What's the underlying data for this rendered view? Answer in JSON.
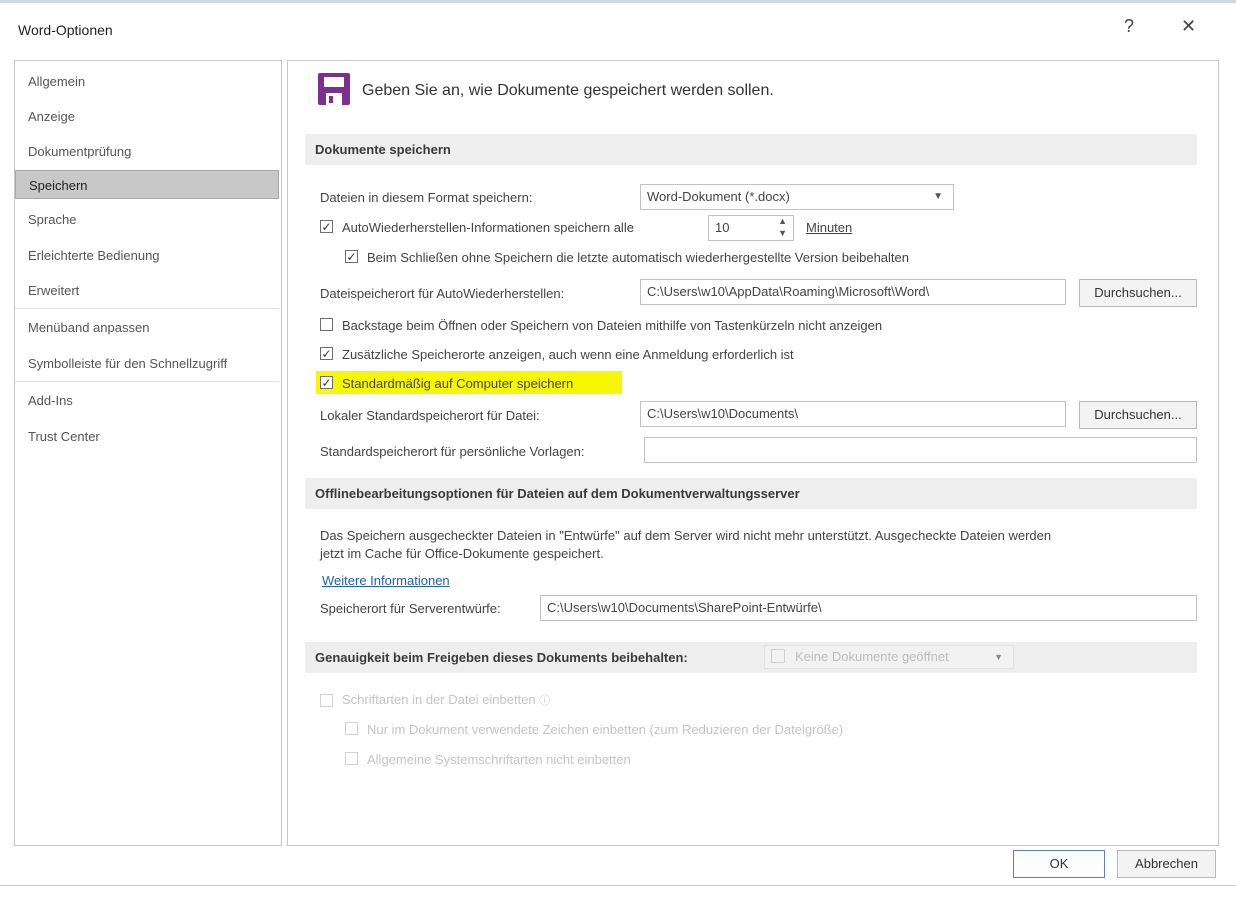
{
  "window": {
    "title": "Word-Optionen",
    "help": "?",
    "close": "✕"
  },
  "sidebar": {
    "items": [
      {
        "label": "Allgemein"
      },
      {
        "label": "Anzeige"
      },
      {
        "label": "Dokumentprüfung"
      },
      {
        "label": "Speichern",
        "selected": true
      },
      {
        "label": "Sprache"
      },
      {
        "label": "Erleichterte Bedienung"
      },
      {
        "label": "Erweitert"
      },
      {
        "label": "Menüband anpassen"
      },
      {
        "label": "Symbolleiste für den Schnellzugriff"
      },
      {
        "label": "Add-Ins"
      },
      {
        "label": "Trust Center"
      }
    ]
  },
  "header": {
    "text": "Geben Sie an, wie Dokumente gespeichert werden sollen.",
    "icon": "save-icon",
    "icon_color": "#7b2f8f"
  },
  "save_docs": {
    "title": "Dokumente speichern",
    "format_label": "Dateien in diesem Format speichern:",
    "format_value": "Word-Dokument (*.docx)",
    "autorecover_label": "AutoWiederherstellen-Informationen speichern alle",
    "autorecover_checked": true,
    "autorecover_minutes": "10",
    "minutes_label": "Minuten",
    "keep_last_label": "Beim Schließen ohne Speichern die letzte automatisch wiederhergestellte Version beibehalten",
    "keep_last_checked": true,
    "autorecover_location_label": "Dateispeicherort für AutoWiederherstellen:",
    "autorecover_location_value": "C:\\Users\\w10\\AppData\\Roaming\\Microsoft\\Word\\",
    "browse_label": "Durchsuchen...",
    "backstage_label": "Backstage beim Öffnen oder Speichern von Dateien mithilfe von Tastenkürzeln nicht anzeigen",
    "backstage_checked": false,
    "additional_label": "Zusätzliche Speicherorte anzeigen, auch wenn eine Anmeldung erforderlich ist",
    "additional_checked": true,
    "default_computer_label": "Standardmäßig auf Computer speichern",
    "default_computer_checked": true,
    "local_default_label": "Lokaler Standardspeicherort für Datei:",
    "local_default_value": "C:\\Users\\w10\\Documents\\",
    "browse2_label": "Durchsuchen...",
    "templates_label": "Standardspeicherort für persönliche Vorlagen:",
    "templates_value": "",
    "highlight_color": "#f7f700"
  },
  "offline": {
    "title": "Offlinebearbeitungsoptionen für Dateien auf dem Dokumentverwaltungsserver",
    "description_line1": "Das Speichern ausgecheckter Dateien in \"Entwürfe\" auf dem Server wird nicht mehr unterstützt. Ausgecheckte Dateien werden",
    "description_line2": "jetzt im Cache für Office-Dokumente gespeichert.",
    "more_info": "Weitere Informationen",
    "server_drafts_label": "Speicherort für Serverentwürfe:",
    "server_drafts_value": "C:\\Users\\w10\\Documents\\SharePoint-Entwürfe\\"
  },
  "fidelity": {
    "title": "Genauigkeit beim Freigeben dieses Dokuments beibehalten:",
    "doc_select": "Keine Dokumente geöffnet",
    "embed_fonts_label": "Schriftarten in der Datei einbetten",
    "embed_only_used_label": "Nur im Dokument verwendete Zeichen einbetten (zum Reduzieren der Dateigröße)",
    "no_common_fonts_label": "Allgemeine Systemschriftarten nicht einbetten"
  },
  "footer": {
    "ok": "OK",
    "cancel": "Abbrechen"
  }
}
